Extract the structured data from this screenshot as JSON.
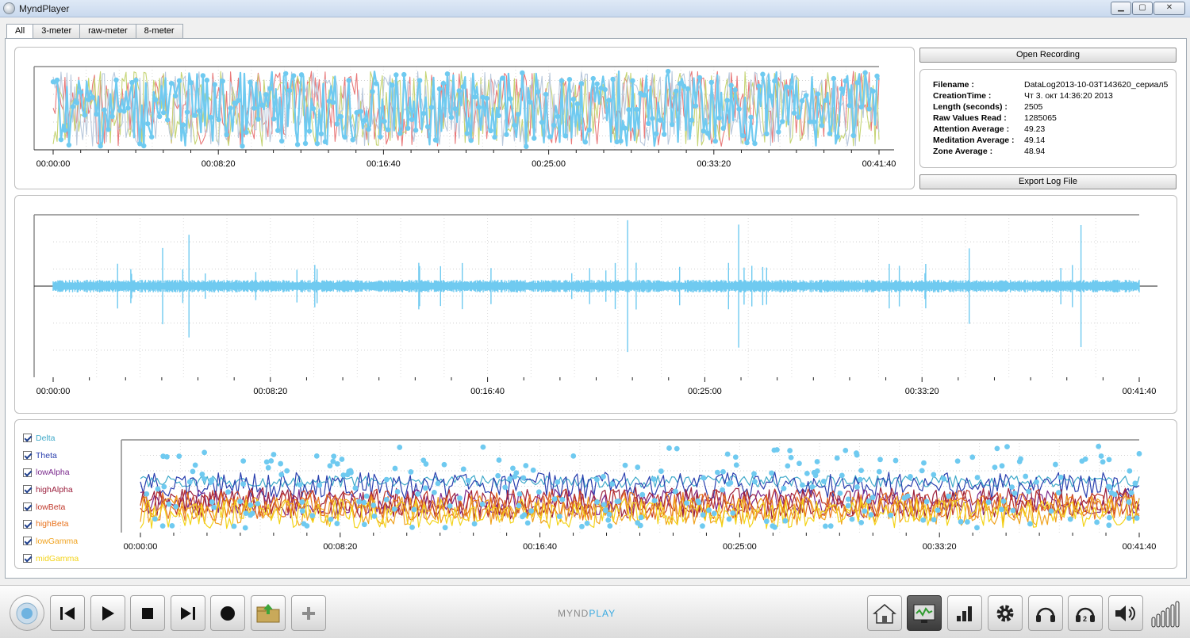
{
  "window": {
    "title": "MyndPlayer",
    "minimize_glyph": "▁",
    "maximize_glyph": "▢",
    "close_glyph": "✕"
  },
  "tabs": [
    {
      "label": "All",
      "active": true
    },
    {
      "label": "3-meter",
      "active": false
    },
    {
      "label": "raw-meter",
      "active": false
    },
    {
      "label": "8-meter",
      "active": false
    }
  ],
  "recording": {
    "open_button": "Open Recording",
    "export_button": "Export Log File",
    "fields": [
      {
        "key": "Filename :",
        "value": "DataLog2013-10-03T143620_сериал5"
      },
      {
        "key": "CreationTime :",
        "value": "Чт 3. окт 14:36:20 2013"
      },
      {
        "key": "Length (seconds) :",
        "value": "2505"
      },
      {
        "key": "Raw Values Read :",
        "value": "1285065"
      },
      {
        "key": "Attention Average :",
        "value": "49.23"
      },
      {
        "key": "Meditation Average :",
        "value": "49.14"
      },
      {
        "key": "Zone Average :",
        "value": "48.94"
      }
    ]
  },
  "chart_data": [
    {
      "type": "line",
      "x_ticks": [
        "00:00:00",
        "00:08:20",
        "00:16:40",
        "00:25:00",
        "00:33:20",
        "00:41:40"
      ],
      "xlim": [
        0,
        2500
      ],
      "grid": true,
      "series": [
        {
          "color": "#e9797a"
        },
        {
          "color": "#c5d474"
        },
        {
          "color": "#b8c8dc"
        },
        {
          "color": "#6fcaf0"
        }
      ]
    },
    {
      "type": "line",
      "x_ticks": [
        "00:00:00",
        "00:08:20",
        "00:16:40",
        "00:25:00",
        "00:33:20",
        "00:41:40"
      ],
      "xlim": [
        0,
        2500
      ],
      "grid": true,
      "series": [
        {
          "color": "#6fcaf0"
        }
      ]
    },
    {
      "type": "line",
      "x_ticks": [
        "00:00:00",
        "00:08:20",
        "00:16:40",
        "00:25:00",
        "00:33:20",
        "00:41:40"
      ],
      "xlim": [
        0,
        2500
      ],
      "grid": true,
      "series": [
        {
          "name": "Delta",
          "color": "#3fa9c9"
        },
        {
          "name": "Theta",
          "color": "#2a3fae"
        },
        {
          "name": "lowAlpha",
          "color": "#7b2a8d"
        },
        {
          "name": "highAlpha",
          "color": "#9b1f3c"
        },
        {
          "name": "lowBeta",
          "color": "#c0392b"
        },
        {
          "name": "highBeta",
          "color": "#e8731e"
        },
        {
          "name": "lowGamma",
          "color": "#f0a21e"
        },
        {
          "name": "midGamma",
          "color": "#f3d318"
        }
      ]
    }
  ],
  "toolbar": {
    "logo_part1": "MYND",
    "logo_part2": "PLAY",
    "left_icons": [
      "disc-icon",
      "skip-back-icon",
      "play-icon",
      "stop-icon",
      "skip-forward-icon",
      "record-icon",
      "open-folder-icon",
      "add-icon"
    ],
    "right_icons": [
      "home-icon",
      "monitor-icon",
      "bar-chart-icon",
      "gear-icon",
      "headphones-icon",
      "headphones-2-icon",
      "speaker-icon"
    ]
  }
}
